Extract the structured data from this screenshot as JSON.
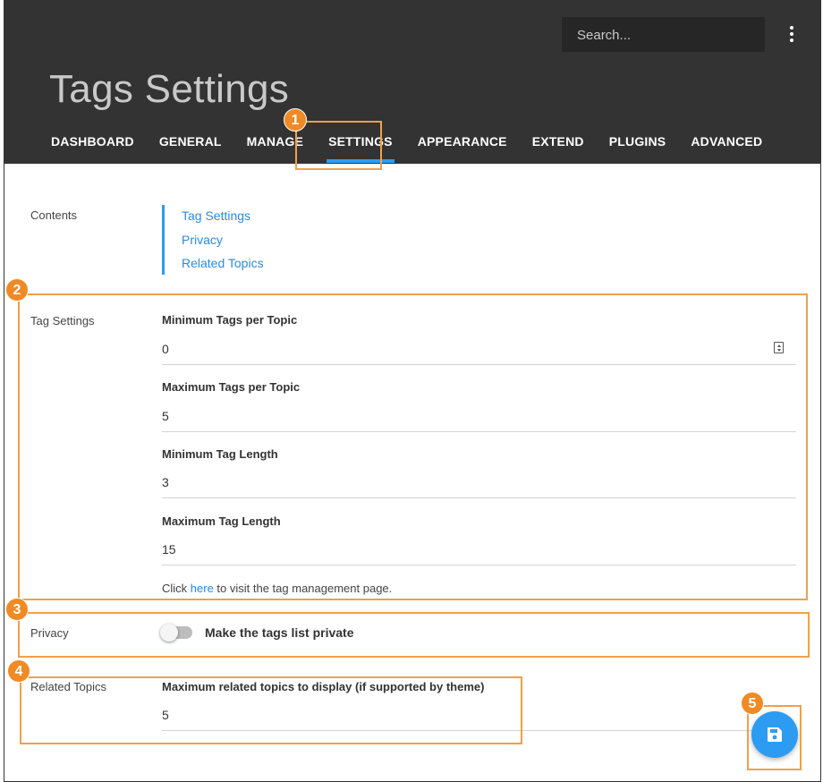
{
  "header": {
    "search_placeholder": "Search...",
    "title": "Tags Settings",
    "tabs": [
      {
        "label": "DASHBOARD"
      },
      {
        "label": "GENERAL"
      },
      {
        "label": "MANAGE"
      },
      {
        "label": "SETTINGS",
        "active": true
      },
      {
        "label": "APPEARANCE"
      },
      {
        "label": "EXTEND"
      },
      {
        "label": "PLUGINS"
      },
      {
        "label": "ADVANCED"
      }
    ]
  },
  "contents": {
    "label": "Contents",
    "links": [
      "Tag Settings",
      "Privacy",
      "Related Topics"
    ]
  },
  "tag_settings": {
    "label": "Tag Settings",
    "fields": [
      {
        "label": "Minimum Tags per Topic",
        "value": "0"
      },
      {
        "label": "Maximum Tags per Topic",
        "value": "5"
      },
      {
        "label": "Minimum Tag Length",
        "value": "3"
      },
      {
        "label": "Maximum Tag Length",
        "value": "15"
      }
    ],
    "help_prefix": "Click ",
    "help_link": "here",
    "help_suffix": " to visit the tag management page."
  },
  "privacy": {
    "label": "Privacy",
    "toggle_label": "Make the tags list private",
    "toggle_on": false
  },
  "related_topics": {
    "label": "Related Topics",
    "field_label": "Maximum related topics to display (if supported by theme)",
    "value": "5"
  },
  "fab": {
    "icon": "save-icon"
  },
  "callouts": [
    "1",
    "2",
    "3",
    "4",
    "5"
  ],
  "colors": {
    "header_bg": "#333333",
    "accent": "#2c9cf2",
    "callout": "#f08a24"
  }
}
